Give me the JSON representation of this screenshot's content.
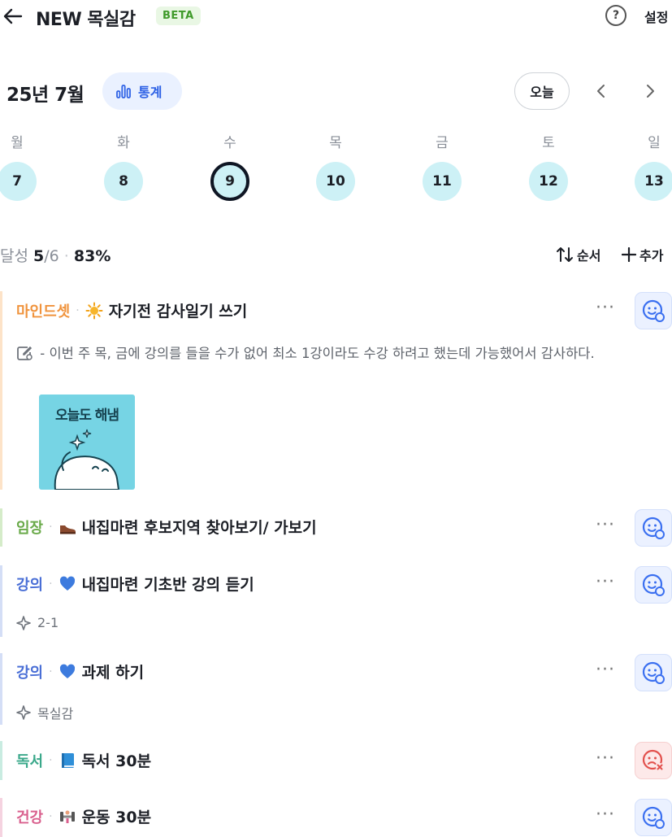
{
  "header": {
    "title": "NEW 목실감",
    "badge": "BETA",
    "help_symbol": "?",
    "settings_label": "설정"
  },
  "calendar": {
    "month_label": "25년 7월",
    "stats_label": "통계",
    "today_label": "오늘",
    "weekdays": [
      "월",
      "화",
      "수",
      "목",
      "금",
      "토",
      "일"
    ],
    "days": [
      "7",
      "8",
      "9",
      "10",
      "11",
      "12",
      "13"
    ],
    "selected_day": "9"
  },
  "achievement": {
    "label": "달성",
    "done": "5",
    "total": "/6",
    "separator": "·",
    "percent": "83%"
  },
  "toolbar": {
    "order_label": "순서",
    "add_label": "추가"
  },
  "tasks": [
    {
      "category": "마인드셋",
      "category_color": "#f0933c",
      "bar_color": "#fde3c8",
      "title": "자기전 감사일기 쓰기",
      "emoji": "sun-icon",
      "memo": "- 이번 주 목, 금에 강의를 들을 수가 없어 최소 1강이라도 수강 하려고 했는데 가능했어서 감사하다.",
      "sticker_text": "오늘도 해냄",
      "status": "done"
    },
    {
      "category": "임장",
      "category_color": "#6aaa4a",
      "bar_color": "#d5ecc9",
      "title": "내집마련 후보지역 찾아보기/ 가보기",
      "emoji": "shoe-icon",
      "status": "done"
    },
    {
      "category": "강의",
      "category_color": "#4a6fd6",
      "bar_color": "#d4def6",
      "title": "내집마련 기초반 강의 듣기",
      "emoji": "blue-heart-icon",
      "sub": "2-1",
      "status": "done"
    },
    {
      "category": "강의",
      "category_color": "#4a6fd6",
      "bar_color": "#d4def6",
      "title": "과제 하기",
      "emoji": "blue-heart-icon",
      "sub": "목실감",
      "status": "done"
    },
    {
      "category": "독서",
      "category_color": "#3aa88a",
      "bar_color": "#c9ece1",
      "title": "독서 30분",
      "emoji": "book-icon",
      "status": "failed"
    },
    {
      "category": "건강",
      "category_color": "#d95f8d",
      "bar_color": "#f5d3e0",
      "title": "운동 30분",
      "emoji": "dumbbell-icon",
      "status": "done"
    }
  ],
  "colors": {
    "accent": "#2e62e6",
    "day_bg": "#cdf1f6",
    "fail": "#e2504c"
  }
}
